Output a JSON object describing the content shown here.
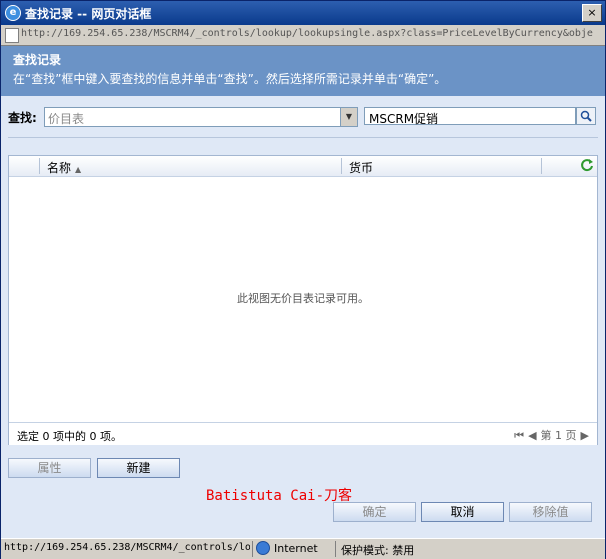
{
  "window": {
    "title": "查找记录 -- 网页对话框",
    "close_label": "×"
  },
  "address": {
    "url": "http://169.254.65.238/MSCRM4/_controls/lookup/lookupsingle.aspx?class=PriceLevelByCurrency&obje"
  },
  "header": {
    "title": "查找记录",
    "description": "在“查找”框中键入要查找的信息并单击“查找”。然后选择所需记录并单击“确定”。"
  },
  "search": {
    "label": "查找:",
    "look_in_value": "价目表",
    "query_value": "MSCRM促销"
  },
  "grid": {
    "columns": [
      "名称",
      "货币"
    ],
    "sort_indicator": "▲",
    "empty_message": "此视图无价目表记录可用。",
    "selection_status": "选定 0 项中的 0 项。",
    "pager": {
      "first": "⏮",
      "prev": "◀",
      "page_label": "第 1 页",
      "next": "▶"
    }
  },
  "actions": {
    "properties": "属性",
    "new": "新建",
    "ok": "确定",
    "cancel": "取消",
    "remove_value": "移除值"
  },
  "watermark": "Batistuta Cai-刀客",
  "status_bar": {
    "url": "http://169.254.65.238/MSCRM4/_controls/lo",
    "zone": "Internet",
    "protected_mode": "保护模式: 禁用"
  },
  "colors": {
    "title_bar": "#0a3a8c",
    "header": "#6b93c6",
    "dialog_bg": "#dfe8f6",
    "watermark": "#ee0000"
  }
}
